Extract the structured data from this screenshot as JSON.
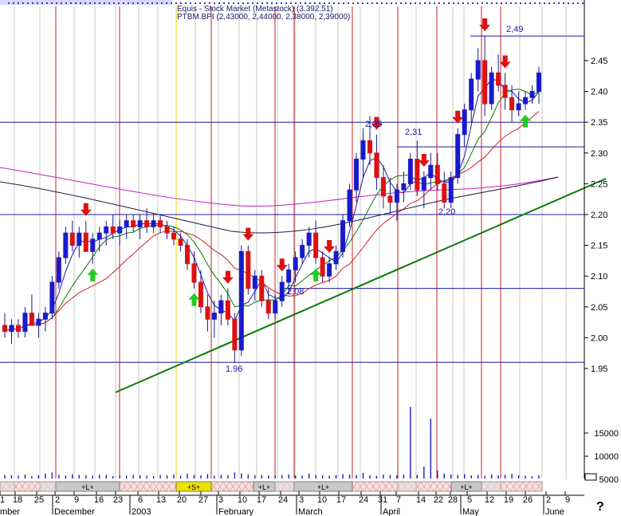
{
  "header": {
    "line1": "Equis - Stock Market (Metastock) (3.392.51)",
    "line2": "PTBM.BPI (2,43000, 2,44000, 2,38000, 2,39000)"
  },
  "chart_data": {
    "type": "candlestick",
    "title": "PTBM.BPI (2,43000, 2,44000, 2,38000, 2,39000)",
    "ohlc_last": {
      "open": 2.43,
      "high": 2.44,
      "low": 2.38,
      "close": 2.39
    },
    "price_axis": {
      "min": 1.95,
      "max": 2.45,
      "ticks": [
        "2.45",
        "2.40",
        "2.35",
        "2.30",
        "2.25",
        "2.20",
        "2.15",
        "2.10",
        "2.05",
        "2.00",
        "1.95"
      ]
    },
    "volume_axis": {
      "ticks": [
        "15000",
        "10000",
        "5000"
      ]
    },
    "x_day_ticks": [
      "1",
      "18",
      "25",
      "2",
      "9",
      "16",
      "23",
      "6",
      "13",
      "20",
      "27",
      "3",
      "10",
      "17",
      "24",
      "3",
      "10",
      "17",
      "24",
      "31",
      "7",
      "14",
      "22",
      "28",
      "5",
      "12",
      "19",
      "26",
      "2",
      "9"
    ],
    "x_month_labels": [
      "mber",
      "December",
      "2003",
      "February",
      "March",
      "April",
      "May",
      "June"
    ],
    "period_labels": [
      "+L+",
      "+S+",
      "+L+",
      "+L+",
      "+L+"
    ],
    "horizontal_levels": [
      {
        "value": 2.49,
        "label": "2,49"
      },
      {
        "value": 2.35,
        "label": "2,35"
      },
      {
        "value": 2.31,
        "label": "2,31"
      },
      {
        "value": 2.2,
        "label": "2,20"
      },
      {
        "value": 2.08,
        "label": "2,08"
      },
      {
        "value": 1.96,
        "label": "1.96"
      }
    ],
    "trendline": {
      "from": {
        "date_index": 0,
        "price": 1.92
      },
      "to": {
        "date_index": 1,
        "price": 2.25
      }
    },
    "candles": [
      {
        "o": 2.02,
        "h": 2.04,
        "l": 2.0,
        "c": 2.01
      },
      {
        "o": 2.01,
        "h": 2.03,
        "l": 1.99,
        "c": 2.02
      },
      {
        "o": 2.02,
        "h": 2.03,
        "l": 2.0,
        "c": 2.01
      },
      {
        "o": 2.01,
        "h": 2.05,
        "l": 2.0,
        "c": 2.04
      },
      {
        "o": 2.04,
        "h": 2.07,
        "l": 2.02,
        "c": 2.02
      },
      {
        "o": 2.02,
        "h": 2.04,
        "l": 2.0,
        "c": 2.03
      },
      {
        "o": 2.03,
        "h": 2.05,
        "l": 2.01,
        "c": 2.04
      },
      {
        "o": 2.04,
        "h": 2.1,
        "l": 2.03,
        "c": 2.09
      },
      {
        "o": 2.09,
        "h": 2.14,
        "l": 2.08,
        "c": 2.13
      },
      {
        "o": 2.13,
        "h": 2.18,
        "l": 2.12,
        "c": 2.17
      },
      {
        "o": 2.17,
        "h": 2.19,
        "l": 2.14,
        "c": 2.15
      },
      {
        "o": 2.15,
        "h": 2.18,
        "l": 2.13,
        "c": 2.17
      },
      {
        "o": 2.17,
        "h": 2.19,
        "l": 2.14,
        "c": 2.14
      },
      {
        "o": 2.14,
        "h": 2.17,
        "l": 2.12,
        "c": 2.16
      },
      {
        "o": 2.16,
        "h": 2.18,
        "l": 2.14,
        "c": 2.17
      },
      {
        "o": 2.17,
        "h": 2.19,
        "l": 2.15,
        "c": 2.18
      },
      {
        "o": 2.18,
        "h": 2.2,
        "l": 2.16,
        "c": 2.17
      },
      {
        "o": 2.17,
        "h": 2.19,
        "l": 2.15,
        "c": 2.18
      },
      {
        "o": 2.18,
        "h": 2.2,
        "l": 2.16,
        "c": 2.19
      },
      {
        "o": 2.19,
        "h": 2.2,
        "l": 2.17,
        "c": 2.18
      },
      {
        "o": 2.18,
        "h": 2.2,
        "l": 2.16,
        "c": 2.19
      },
      {
        "o": 2.19,
        "h": 2.21,
        "l": 2.17,
        "c": 2.18
      },
      {
        "o": 2.18,
        "h": 2.2,
        "l": 2.17,
        "c": 2.19
      },
      {
        "o": 2.19,
        "h": 2.2,
        "l": 2.17,
        "c": 2.18
      },
      {
        "o": 2.18,
        "h": 2.19,
        "l": 2.16,
        "c": 2.17
      },
      {
        "o": 2.17,
        "h": 2.18,
        "l": 2.15,
        "c": 2.16
      },
      {
        "o": 2.16,
        "h": 2.17,
        "l": 2.14,
        "c": 2.15
      },
      {
        "o": 2.15,
        "h": 2.16,
        "l": 2.11,
        "c": 2.12
      },
      {
        "o": 2.12,
        "h": 2.14,
        "l": 2.08,
        "c": 2.09
      },
      {
        "o": 2.09,
        "h": 2.11,
        "l": 2.04,
        "c": 2.05
      },
      {
        "o": 2.05,
        "h": 2.07,
        "l": 2.01,
        "c": 2.03
      },
      {
        "o": 2.03,
        "h": 2.06,
        "l": 2.0,
        "c": 2.04
      },
      {
        "o": 2.04,
        "h": 2.07,
        "l": 2.02,
        "c": 2.06
      },
      {
        "o": 2.06,
        "h": 2.08,
        "l": 2.02,
        "c": 2.03
      },
      {
        "o": 2.03,
        "h": 2.04,
        "l": 1.96,
        "c": 1.98
      },
      {
        "o": 1.98,
        "h": 2.15,
        "l": 1.97,
        "c": 2.14
      },
      {
        "o": 2.14,
        "h": 2.15,
        "l": 2.07,
        "c": 2.08
      },
      {
        "o": 2.08,
        "h": 2.11,
        "l": 2.06,
        "c": 2.1
      },
      {
        "o": 2.1,
        "h": 2.11,
        "l": 2.05,
        "c": 2.06
      },
      {
        "o": 2.06,
        "h": 2.08,
        "l": 2.03,
        "c": 2.04
      },
      {
        "o": 2.04,
        "h": 2.07,
        "l": 2.03,
        "c": 2.06
      },
      {
        "o": 2.06,
        "h": 2.1,
        "l": 2.05,
        "c": 2.09
      },
      {
        "o": 2.09,
        "h": 2.12,
        "l": 2.07,
        "c": 2.11
      },
      {
        "o": 2.11,
        "h": 2.14,
        "l": 2.09,
        "c": 2.13
      },
      {
        "o": 2.13,
        "h": 2.16,
        "l": 2.12,
        "c": 2.15
      },
      {
        "o": 2.15,
        "h": 2.18,
        "l": 2.13,
        "c": 2.17
      },
      {
        "o": 2.17,
        "h": 2.19,
        "l": 2.12,
        "c": 2.13
      },
      {
        "o": 2.13,
        "h": 2.14,
        "l": 2.09,
        "c": 2.1
      },
      {
        "o": 2.1,
        "h": 2.13,
        "l": 2.09,
        "c": 2.12
      },
      {
        "o": 2.12,
        "h": 2.15,
        "l": 2.11,
        "c": 2.14
      },
      {
        "o": 2.14,
        "h": 2.2,
        "l": 2.13,
        "c": 2.19
      },
      {
        "o": 2.19,
        "h": 2.25,
        "l": 2.18,
        "c": 2.24
      },
      {
        "o": 2.24,
        "h": 2.3,
        "l": 2.22,
        "c": 2.29
      },
      {
        "o": 2.29,
        "h": 2.34,
        "l": 2.26,
        "c": 2.32
      },
      {
        "o": 2.32,
        "h": 2.36,
        "l": 2.28,
        "c": 2.3
      },
      {
        "o": 2.3,
        "h": 2.33,
        "l": 2.24,
        "c": 2.26
      },
      {
        "o": 2.26,
        "h": 2.28,
        "l": 2.21,
        "c": 2.23
      },
      {
        "o": 2.23,
        "h": 2.26,
        "l": 2.2,
        "c": 2.22
      },
      {
        "o": 2.22,
        "h": 2.25,
        "l": 2.19,
        "c": 2.24
      },
      {
        "o": 2.24,
        "h": 2.27,
        "l": 2.22,
        "c": 2.25
      },
      {
        "o": 2.25,
        "h": 2.3,
        "l": 2.24,
        "c": 2.29
      },
      {
        "o": 2.29,
        "h": 2.32,
        "l": 2.23,
        "c": 2.24
      },
      {
        "o": 2.24,
        "h": 2.27,
        "l": 2.21,
        "c": 2.26
      },
      {
        "o": 2.26,
        "h": 2.3,
        "l": 2.24,
        "c": 2.28
      },
      {
        "o": 2.28,
        "h": 2.3,
        "l": 2.24,
        "c": 2.25
      },
      {
        "o": 2.25,
        "h": 2.27,
        "l": 2.21,
        "c": 2.22
      },
      {
        "o": 2.22,
        "h": 2.27,
        "l": 2.21,
        "c": 2.26
      },
      {
        "o": 2.26,
        "h": 2.34,
        "l": 2.25,
        "c": 2.33
      },
      {
        "o": 2.33,
        "h": 2.38,
        "l": 2.31,
        "c": 2.37
      },
      {
        "o": 2.37,
        "h": 2.43,
        "l": 2.35,
        "c": 2.42
      },
      {
        "o": 2.42,
        "h": 2.47,
        "l": 2.4,
        "c": 2.45
      },
      {
        "o": 2.45,
        "h": 2.49,
        "l": 2.36,
        "c": 2.38
      },
      {
        "o": 2.38,
        "h": 2.44,
        "l": 2.37,
        "c": 2.43
      },
      {
        "o": 2.43,
        "h": 2.46,
        "l": 2.4,
        "c": 2.41
      },
      {
        "o": 2.41,
        "h": 2.43,
        "l": 2.37,
        "c": 2.39
      },
      {
        "o": 2.39,
        "h": 2.41,
        "l": 2.35,
        "c": 2.37
      },
      {
        "o": 2.37,
        "h": 2.4,
        "l": 2.36,
        "c": 2.38
      },
      {
        "o": 2.38,
        "h": 2.4,
        "l": 2.37,
        "c": 2.39
      },
      {
        "o": 2.39,
        "h": 2.41,
        "l": 2.38,
        "c": 2.4
      },
      {
        "o": 2.4,
        "h": 2.44,
        "l": 2.38,
        "c": 2.43
      }
    ],
    "volume": [
      900,
      800,
      700,
      1000,
      600,
      800,
      1200,
      1500,
      900,
      700,
      1100,
      900,
      800,
      700,
      1000,
      900,
      600,
      800,
      700,
      900,
      800,
      700,
      600,
      900,
      800,
      1000,
      700,
      1200,
      900,
      800,
      1100,
      700,
      900,
      800,
      1500,
      1300,
      1000,
      800,
      900,
      700,
      800,
      900,
      1000,
      800,
      700,
      1200,
      900,
      800,
      700,
      900,
      1100,
      1000,
      900,
      1400,
      800,
      700,
      1000,
      900,
      800,
      1000,
      18000,
      900,
      3000,
      15000,
      2000,
      1200,
      1000,
      900,
      1100,
      800,
      900,
      700,
      1000,
      800,
      900,
      1200,
      800,
      700,
      600,
      800
    ],
    "buy_signal_indices": [
      13,
      28,
      46,
      77
    ],
    "sell_signal_indices": [
      12,
      33,
      36,
      41,
      48,
      55,
      62,
      67,
      71,
      74
    ]
  }
}
